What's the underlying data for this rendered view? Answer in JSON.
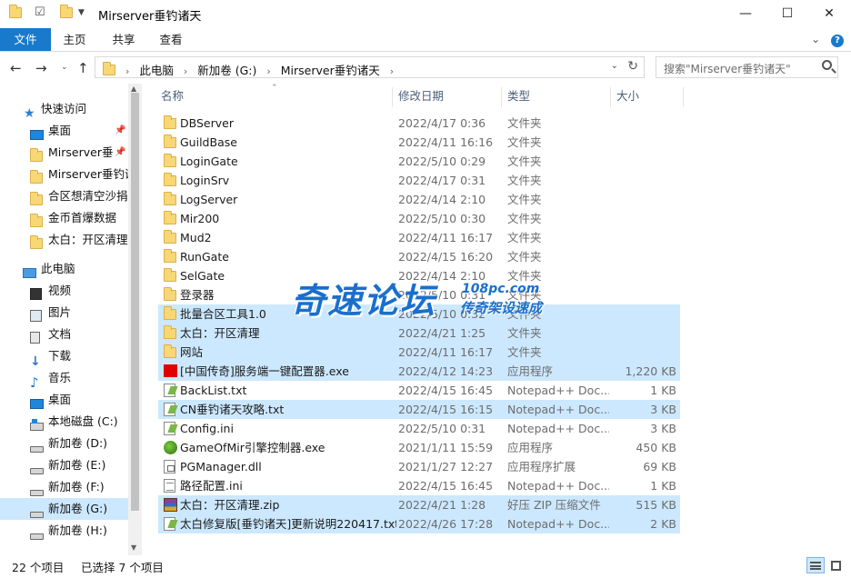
{
  "window": {
    "title": "Mirserver垂钓诸天",
    "minimize": "—",
    "maximize": "☐",
    "close": "✕"
  },
  "ribbon": {
    "tabs": [
      "文件",
      "主页",
      "共享",
      "查看"
    ],
    "expand": "⌄"
  },
  "address": {
    "crumbs": [
      "此电脑",
      "新加卷 (G:)",
      "Mirserver垂钓诸天"
    ],
    "search_placeholder": "搜索\"Mirserver垂钓诸天\""
  },
  "nav": {
    "quick_access": "快速访问",
    "pinned": [
      {
        "label": "桌面",
        "icon": "desktop-icon",
        "pin": true
      },
      {
        "label": "Mirserver垂",
        "icon": "folder-icon",
        "pin": true
      },
      {
        "label": "Mirserver垂钓诸",
        "icon": "folder-icon",
        "pin": false
      },
      {
        "label": "合区想清空沙捐",
        "icon": "folder-icon",
        "pin": false
      },
      {
        "label": "金币首爆数据",
        "icon": "folder-icon",
        "pin": false
      },
      {
        "label": "太白：开区清理",
        "icon": "folder-icon",
        "pin": false
      }
    ],
    "this_pc": "此电脑",
    "pc_items": [
      {
        "label": "视频",
        "icon": "video-icon"
      },
      {
        "label": "图片",
        "icon": "pictures-icon"
      },
      {
        "label": "文档",
        "icon": "documents-icon"
      },
      {
        "label": "下载",
        "icon": "download-icon"
      },
      {
        "label": "音乐",
        "icon": "music-icon"
      },
      {
        "label": "桌面",
        "icon": "desktop-icon"
      },
      {
        "label": "本地磁盘 (C:)",
        "icon": "os-drive-icon"
      },
      {
        "label": "新加卷 (D:)",
        "icon": "drive-icon"
      },
      {
        "label": "新加卷 (E:)",
        "icon": "drive-icon"
      },
      {
        "label": "新加卷 (F:)",
        "icon": "drive-icon"
      },
      {
        "label": "新加卷 (G:)",
        "icon": "drive-icon",
        "selected": true
      },
      {
        "label": "新加卷 (H:)",
        "icon": "drive-icon"
      }
    ]
  },
  "columns": {
    "name": "名称",
    "date": "修改日期",
    "type": "类型",
    "size": "大小"
  },
  "files": [
    {
      "name": "DBServer",
      "date": "2022/4/17 0:36",
      "type": "文件夹",
      "size": "",
      "icon": "folder-icon",
      "selected": false
    },
    {
      "name": "GuildBase",
      "date": "2022/4/11 16:16",
      "type": "文件夹",
      "size": "",
      "icon": "folder-icon",
      "selected": false
    },
    {
      "name": "LoginGate",
      "date": "2022/5/10 0:29",
      "type": "文件夹",
      "size": "",
      "icon": "folder-icon",
      "selected": false
    },
    {
      "name": "LoginSrv",
      "date": "2022/4/17 0:31",
      "type": "文件夹",
      "size": "",
      "icon": "folder-icon",
      "selected": false
    },
    {
      "name": "LogServer",
      "date": "2022/4/14 2:10",
      "type": "文件夹",
      "size": "",
      "icon": "folder-icon",
      "selected": false
    },
    {
      "name": "Mir200",
      "date": "2022/5/10 0:30",
      "type": "文件夹",
      "size": "",
      "icon": "folder-icon",
      "selected": false
    },
    {
      "name": "Mud2",
      "date": "2022/4/11 16:17",
      "type": "文件夹",
      "size": "",
      "icon": "folder-icon",
      "selected": false
    },
    {
      "name": "RunGate",
      "date": "2022/4/15 16:20",
      "type": "文件夹",
      "size": "",
      "icon": "folder-icon",
      "selected": false
    },
    {
      "name": "SelGate",
      "date": "2022/4/14 2:10",
      "type": "文件夹",
      "size": "",
      "icon": "folder-icon",
      "selected": false
    },
    {
      "name": "登录器",
      "date": "2022/5/10 0:31",
      "type": "文件夹",
      "size": "",
      "icon": "folder-icon",
      "selected": false
    },
    {
      "name": "批量合区工具1.0",
      "date": "2022/5/10 0:32",
      "type": "文件夹",
      "size": "",
      "icon": "folder-icon",
      "selected": true
    },
    {
      "name": "太白：开区清理",
      "date": "2022/4/21 1:25",
      "type": "文件夹",
      "size": "",
      "icon": "folder-icon",
      "selected": true
    },
    {
      "name": "网站",
      "date": "2022/4/11 16:17",
      "type": "文件夹",
      "size": "",
      "icon": "folder-icon",
      "selected": true
    },
    {
      "name": "[中国传奇]服务端一键配置器.exe",
      "date": "2022/4/12 14:23",
      "type": "应用程序",
      "size": "1,220 KB",
      "icon": "exe-red-icon",
      "selected": true
    },
    {
      "name": "BackList.txt",
      "date": "2022/4/15 16:45",
      "type": "Notepad++ Doc...",
      "size": "1 KB",
      "icon": "text-file-icon",
      "selected": false
    },
    {
      "name": "CN垂钓诸天攻略.txt",
      "date": "2022/4/15 16:15",
      "type": "Notepad++ Doc...",
      "size": "3 KB",
      "icon": "text-file-icon",
      "selected": true
    },
    {
      "name": "Config.ini",
      "date": "2022/5/10 0:31",
      "type": "Notepad++ Doc...",
      "size": "3 KB",
      "icon": "text-file-icon",
      "selected": false
    },
    {
      "name": "GameOfMir引擎控制器.exe",
      "date": "2021/1/11 15:59",
      "type": "应用程序",
      "size": "450 KB",
      "icon": "exe-game-icon",
      "selected": false
    },
    {
      "name": "PGManager.dll",
      "date": "2021/1/27 12:27",
      "type": "应用程序扩展",
      "size": "69 KB",
      "icon": "dll-icon",
      "selected": false
    },
    {
      "name": "路径配置.ini",
      "date": "2022/4/15 16:45",
      "type": "Notepad++ Doc...",
      "size": "1 KB",
      "icon": "ini-icon",
      "selected": false
    },
    {
      "name": "太白：开区清理.zip",
      "date": "2022/4/21 1:28",
      "type": "好压 ZIP 压缩文件",
      "size": "515 KB",
      "icon": "zip-icon",
      "selected": true
    },
    {
      "name": "太白修复版[垂钓诸天]更新说明220417.txt",
      "date": "2022/4/26 17:28",
      "type": "Notepad++ Doc...",
      "size": "2 KB",
      "icon": "text-file-icon",
      "selected": true
    }
  ],
  "watermark": {
    "main": "奇速论坛",
    "url": "108pc.com",
    "sub": "传奇架设速成"
  },
  "status": {
    "count": "22 个项目",
    "selected": "已选择 7 个项目"
  }
}
